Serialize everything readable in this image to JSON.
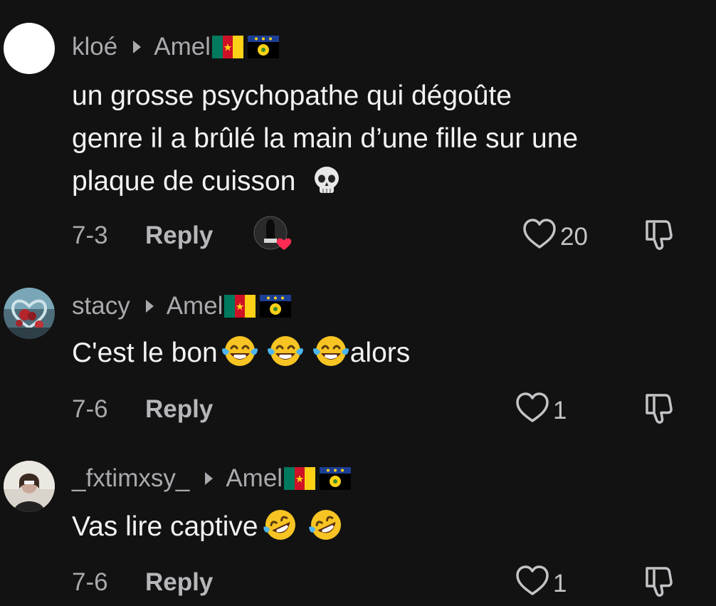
{
  "comments": [
    {
      "author": "kloé",
      "reply_to": "Amel",
      "text_lines": [
        "un grosse psychopathe qui dégoûte",
        "genre il a brûlé la main d’une fille sur une",
        "plaque de cuisson "
      ],
      "date": "7-3",
      "reply_label": "Reply",
      "likes": "20",
      "liked_by_creator": true,
      "icons": [
        "white-avatar",
        "caret-right-icon",
        "cameroon-flag-icon",
        "guadeloupe-flag-icon",
        "skull-emoji",
        "creator-like-badge",
        "heart-icon",
        "dislike-icon"
      ]
    },
    {
      "author": "stacy",
      "reply_to": "Amel",
      "text_before": "C'est le bon",
      "text_after": "alors",
      "date": "7-6",
      "reply_label": "Reply",
      "likes": "1",
      "icons": [
        "heart-art-avatar",
        "caret-right-icon",
        "cameroon-flag-icon",
        "guadeloupe-flag-icon",
        "tears-of-joy-emoji",
        "heart-icon",
        "dislike-icon"
      ]
    },
    {
      "author": "_fxtimxsy_",
      "reply_to": "Amel",
      "text_before": "Vas lire captive",
      "date": "7-6",
      "reply_label": "Reply",
      "likes": "1",
      "icons": [
        "portrait-avatar",
        "caret-right-icon",
        "cameroon-flag-icon",
        "guadeloupe-flag-icon",
        "rofl-emoji",
        "heart-icon",
        "dislike-icon"
      ]
    }
  ],
  "colors": {
    "background": "#121212",
    "primary_text": "#f3f3f3",
    "secondary_text": "#a9a9ae",
    "heart_red": "#fe2c55"
  }
}
